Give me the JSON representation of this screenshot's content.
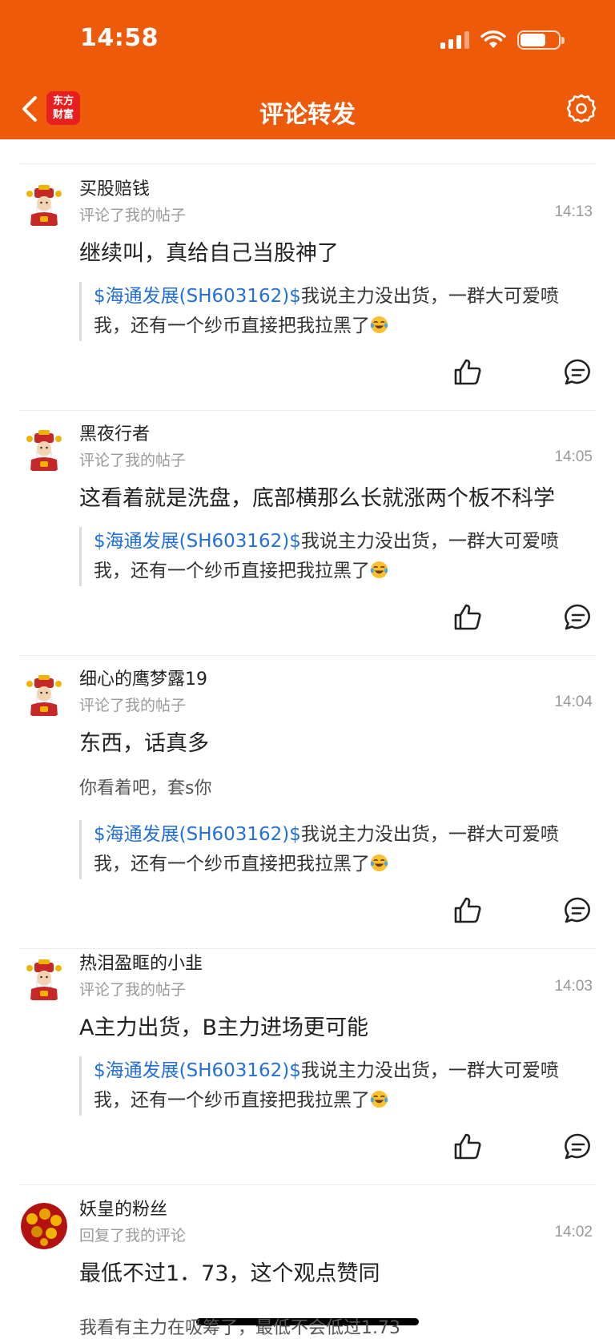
{
  "status_bar": {
    "time": "14:58"
  },
  "nav": {
    "title": "评论转发",
    "logo_text": "东方财富"
  },
  "colors": {
    "header_bg": "#ec5a0a",
    "link_blue": "#2470d8"
  },
  "quote_text": {
    "tag": "$海通发展(SH603162)$",
    "body": "我说主力没出货，一群大可爱喷我，还有一个纱币直接把我拉黑了"
  },
  "items": [
    {
      "name": "买股赔钱",
      "action": "评论了我的帖子",
      "time": "14:13",
      "comment": "继续叫，真给自己当股神了",
      "avatar": "god-of-wealth-avatar"
    },
    {
      "name": "黑夜行者",
      "action": "评论了我的帖子",
      "time": "14:05",
      "comment": "这看着就是洗盘，底部横那么长就涨两个板不科学",
      "avatar": "god-of-wealth-avatar"
    },
    {
      "name": "细心的鹰梦露19",
      "action": "评论了我的帖子",
      "time": "14:04",
      "comment": "东西，话真多",
      "extra": "你看着吧，套s你",
      "avatar": "god-of-wealth-avatar"
    },
    {
      "name": "热泪盈眶的小韭",
      "action": "评论了我的帖子",
      "time": "14:03",
      "comment": "A主力出货，B主力进场更可能",
      "avatar": "god-of-wealth-avatar"
    },
    {
      "name": "妖皇的粉丝",
      "action": "回复了我的评论",
      "time": "14:02",
      "comment": "最低不过1．73，这个观点赞同",
      "extra": "我看有主力在吸筹了，最低不会低过1.73",
      "avatar": "red-lanterns-avatar"
    }
  ]
}
